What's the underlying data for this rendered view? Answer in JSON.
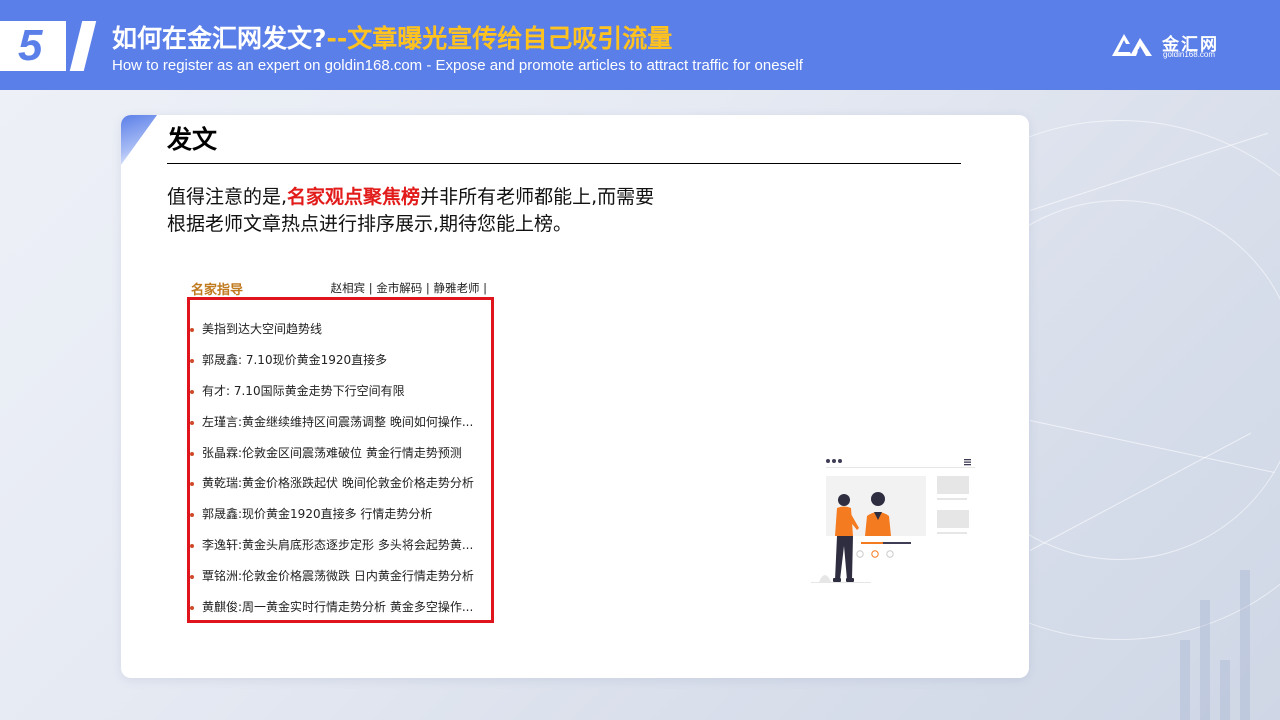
{
  "header": {
    "number": "5",
    "title_main": "如何在金汇网发文?",
    "title_accent": "--文章曝光宣传给自己吸引流量",
    "subtitle_en": "How to register as an expert on goldin168.com - Expose and promote articles to attract traffic for oneself",
    "logo_name": "金汇网",
    "logo_url": "goldin168.com"
  },
  "section": {
    "title": "发文",
    "para_before": "值得注意的是,",
    "para_highlight": "名家观点聚焦榜",
    "para_after_line1": "并非所有老师都能上,而需要",
    "para_line2": "根据老师文章热点进行排序展示,期待您能上榜。"
  },
  "list_block": {
    "category": "名家指导",
    "tags": "赵相宾 | 金市解码 | 静雅老师 |",
    "items": [
      "美指到达大空间趋势线",
      "郭晟鑫: 7.10现价黄金1920直接多",
      "有才: 7.10国际黄金走势下行空间有限",
      "左瑾言:黄金继续维持区间震荡调整 晚间如何操作...",
      "张晶霖:伦敦金区间震荡难破位 黄金行情走势预测",
      "黄乾瑞:黄金价格涨跌起伏 晚间伦敦金价格走势分析",
      "郭晟鑫:现价黄金1920直接多 行情走势分析",
      "李逸轩:黄金头肩底形态逐步定形 多头将会起势黄...",
      "覃铭洲:伦敦金价格震荡微跌 日内黄金行情走势分析",
      "黄麒俊:周一黄金实时行情走势分析 黄金多空操作..."
    ]
  },
  "colors": {
    "header_blue": "#5b7fe8",
    "accent_yellow": "#ffc21f",
    "highlight_red": "#e21b1b",
    "frame_red": "#e0141d",
    "category_brown": "#c07a1e"
  },
  "icons": {
    "logo_mark": "goldin-logo-icon",
    "illustration": "presenter-illustration"
  }
}
